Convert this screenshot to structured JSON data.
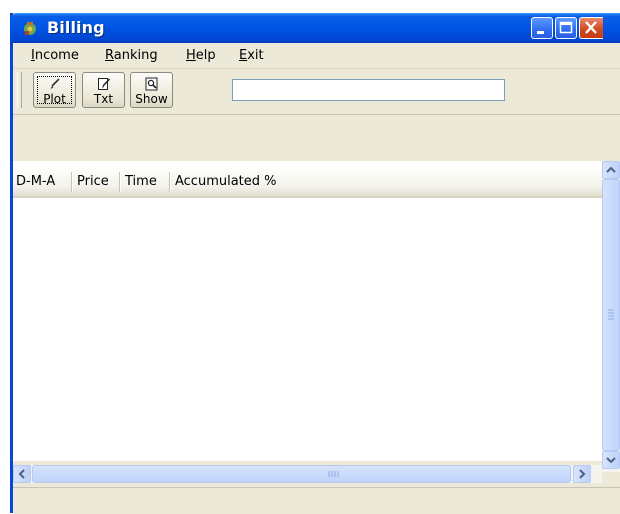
{
  "window": {
    "title": "Billing",
    "app_icon": "money-bag-icon",
    "controls": [
      "minimize",
      "maximize",
      "close"
    ]
  },
  "menu": {
    "income": {
      "mnemonic": "I",
      "rest": "ncome"
    },
    "ranking": {
      "mnemonic": "R",
      "rest": "anking"
    },
    "help": {
      "mnemonic": "H",
      "rest": "elp"
    },
    "exit": {
      "mnemonic": "E",
      "rest": "xit"
    }
  },
  "toolbar": {
    "plot": {
      "label": "Plot",
      "icon": "pen-icon"
    },
    "txt": {
      "label": "Txt",
      "icon": "edit-document-icon"
    },
    "show": {
      "label": "Show",
      "icon": "magnify-page-icon"
    },
    "input_value": ""
  },
  "table": {
    "columns": [
      "D-M-A",
      "Price",
      "Time",
      "Accumulated %"
    ],
    "rows": []
  },
  "colors": {
    "titlebar": "#0055e5",
    "window_bg": "#ece9d8",
    "close_button": "#d24b22"
  }
}
